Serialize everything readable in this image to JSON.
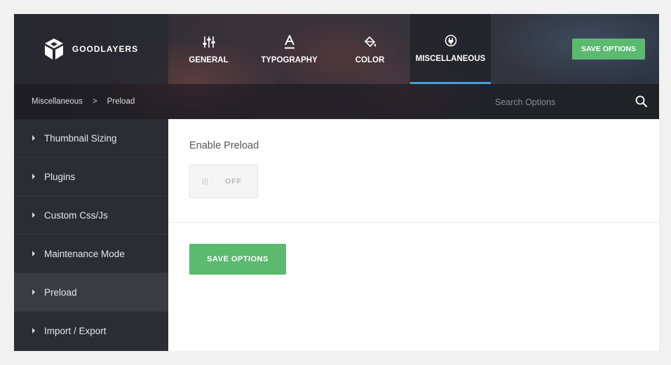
{
  "brand": {
    "name": "GOODLAYERS"
  },
  "tabs": [
    {
      "label": "GENERAL",
      "icon": "sliders-icon"
    },
    {
      "label": "TYPOGRAPHY",
      "icon": "font-a-icon"
    },
    {
      "label": "COLOR",
      "icon": "paint-bucket-icon"
    },
    {
      "label": "MISCELLANEOUS",
      "icon": "plug-icon",
      "active": true
    }
  ],
  "header": {
    "save_label": "SAVE OPTIONS"
  },
  "breadcrumb": {
    "parent": "Miscellaneous",
    "separator": ">",
    "current": "Preload"
  },
  "search": {
    "placeholder": "Search Options"
  },
  "sidebar": {
    "items": [
      {
        "label": "Thumbnail Sizing"
      },
      {
        "label": "Plugins"
      },
      {
        "label": "Custom Css/Js"
      },
      {
        "label": "Maintenance Mode"
      },
      {
        "label": "Preload",
        "active": true
      },
      {
        "label": "Import / Export"
      }
    ]
  },
  "content": {
    "option_label": "Enable Preload",
    "toggle_state": "OFF",
    "save_label": "SAVE OPTIONS"
  },
  "colors": {
    "accent_green": "#5cb970",
    "active_tab_underline": "#4a9fd8",
    "sidebar_bg": "#2c2c34"
  }
}
